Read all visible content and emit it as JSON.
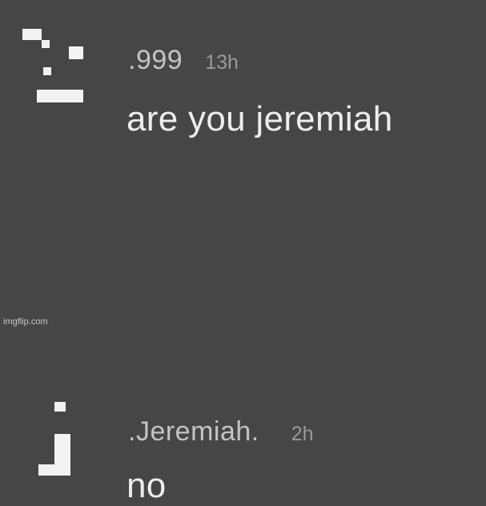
{
  "thread": {
    "comments": [
      {
        "username": ".999",
        "timestamp": "13h",
        "message": "are you jeremiah",
        "avatar_icon": "pixel-avatar-icon"
      },
      {
        "username": ".Jeremiah.",
        "timestamp": "2h",
        "message": "no",
        "avatar_icon": "pixel-avatar-icon"
      }
    ]
  },
  "watermark": "imgflip.com",
  "colors": {
    "background": "#464646",
    "username": "#c4c4c4",
    "timestamp": "#9a9a9a",
    "message": "#ededed"
  }
}
